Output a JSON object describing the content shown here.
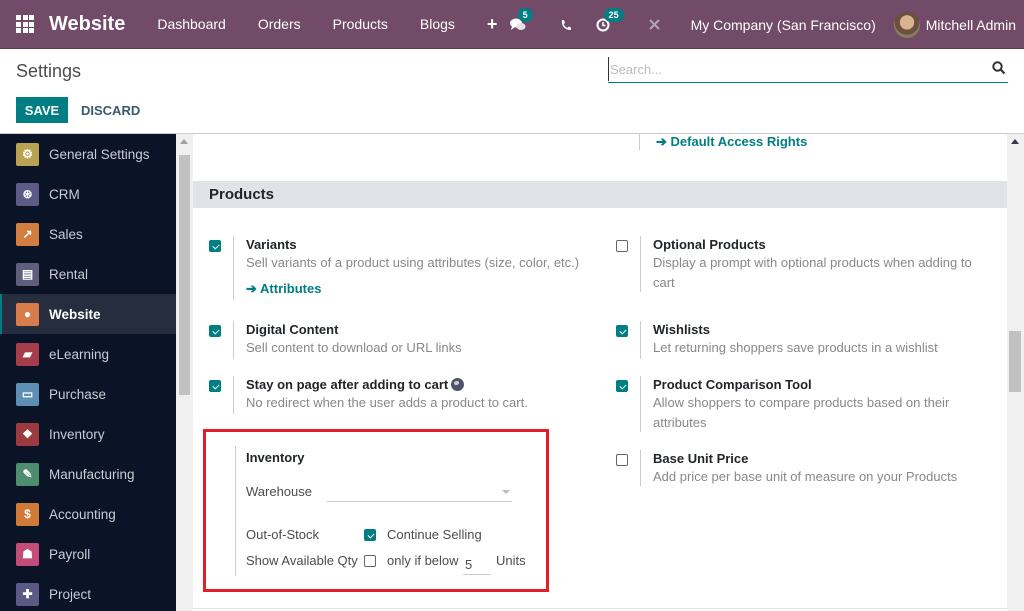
{
  "navbar": {
    "app_name": "Website",
    "menu": [
      "Dashboard",
      "Orders",
      "Products",
      "Blogs"
    ],
    "plus_label": "+",
    "messages_badge": "5",
    "activities_badge": "25",
    "company": "My Company (San Francisco)",
    "user": "Mitchell Admin"
  },
  "control": {
    "title": "Settings",
    "search_placeholder": "Search...",
    "save_label": "SAVE",
    "discard_label": "DISCARD"
  },
  "sidebar": {
    "items": [
      {
        "label": "General Settings",
        "icon": "gear-icon",
        "color": "#b8a352",
        "glyph": "⚙"
      },
      {
        "label": "CRM",
        "icon": "handshake-icon",
        "color": "#5b5b85",
        "glyph": "⊛"
      },
      {
        "label": "Sales",
        "icon": "chart-icon",
        "color": "#d17e3f",
        "glyph": "↗"
      },
      {
        "label": "Rental",
        "icon": "calendar-icon",
        "color": "#5f5f7d",
        "glyph": "▤"
      },
      {
        "label": "Website",
        "icon": "globe-icon",
        "color": "#d77c4a",
        "glyph": "●",
        "active": true
      },
      {
        "label": "eLearning",
        "icon": "elearning-icon",
        "color": "#a63d4a",
        "glyph": "▰"
      },
      {
        "label": "Purchase",
        "icon": "card-icon",
        "color": "#5c8fb2",
        "glyph": "▭"
      },
      {
        "label": "Inventory",
        "icon": "box-icon",
        "color": "#9b3a3f",
        "glyph": "❖"
      },
      {
        "label": "Manufacturing",
        "icon": "wrench-icon",
        "color": "#4e8d6d",
        "glyph": "✎"
      },
      {
        "label": "Accounting",
        "icon": "invoice-icon",
        "color": "#cf7a39",
        "glyph": "$"
      },
      {
        "label": "Payroll",
        "icon": "payroll-icon",
        "color": "#c24d78",
        "glyph": "☗"
      },
      {
        "label": "Project",
        "icon": "puzzle-icon",
        "color": "#5a5a84",
        "glyph": "✚"
      }
    ]
  },
  "main": {
    "top_link": "Default Access Rights",
    "section_title": "Products",
    "settings": [
      {
        "title": "Variants",
        "desc": "Sell variants of a product using attributes (size, color, etc.)",
        "checked": true,
        "link": "Attributes"
      },
      {
        "title": "Optional Products",
        "desc": "Display a prompt with optional products when adding to cart",
        "checked": false
      },
      {
        "title": "Digital Content",
        "desc": "Sell content to download or URL links",
        "checked": true
      },
      {
        "title": "Wishlists",
        "desc": "Let returning shoppers save products in a wishlist",
        "checked": true
      },
      {
        "title": "Stay on page after adding to cart",
        "desc": "No redirect when the user adds a product to cart.",
        "checked": true
      },
      {
        "title": "Product Comparison Tool",
        "desc": "Allow shoppers to compare products based on their attributes",
        "checked": true
      },
      {
        "title": "Base Unit Price",
        "desc": "Add price per base unit of measure on your Products",
        "checked": false
      }
    ],
    "inventory": {
      "title": "Inventory",
      "warehouse_label": "Warehouse",
      "warehouse_value": "",
      "out_of_stock_label": "Out-of-Stock",
      "continue_selling_label": "Continue Selling",
      "continue_selling_checked": true,
      "show_qty_label": "Show Available Qty",
      "show_qty_checked": false,
      "only_if_below_label": "only if below",
      "threshold": "5",
      "units_label": "Units"
    }
  }
}
